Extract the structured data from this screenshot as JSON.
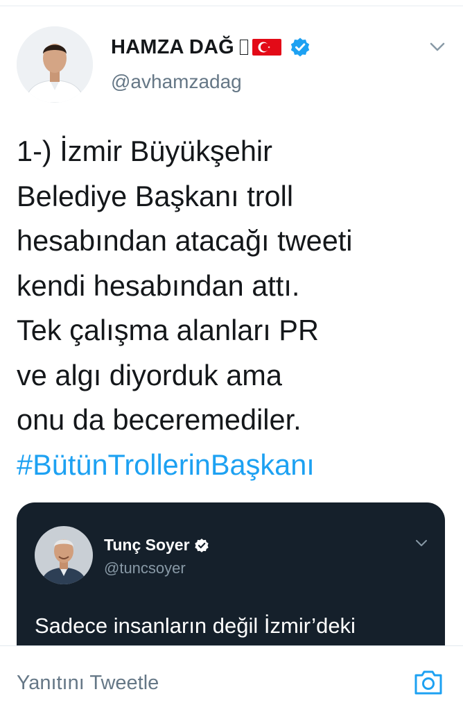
{
  "tweet": {
    "author_name": "HAMZA DAĞ",
    "author_handle": "@avhamzadag",
    "body_lines": [
      "1-) İzmir Büyükşehir",
      "Belediye Başkanı troll",
      "hesabından atacağı tweeti",
      "kendi hesabından attı.",
      "Tek çalışma alanları PR",
      "ve algı diyorduk ama",
      "onu da beceremediler."
    ],
    "hashtag": "#BütünTrollerinBaşkanı"
  },
  "quoted_tweet": {
    "author_name": "Tunç Soyer",
    "author_handle": "@tuncsoyer",
    "text": "Sadece insanların değil İzmir’deki"
  },
  "reply": {
    "placeholder": "Yanıtını Tweetle"
  },
  "icons": {
    "verified": "verified-badge-icon",
    "flag": "turkey-flag-icon",
    "chevron": "chevron-down-icon",
    "camera": "camera-icon"
  },
  "colors": {
    "accent": "#1da1f2",
    "text": "#14171a",
    "muted": "#657786",
    "quote_bg": "#15202b"
  }
}
